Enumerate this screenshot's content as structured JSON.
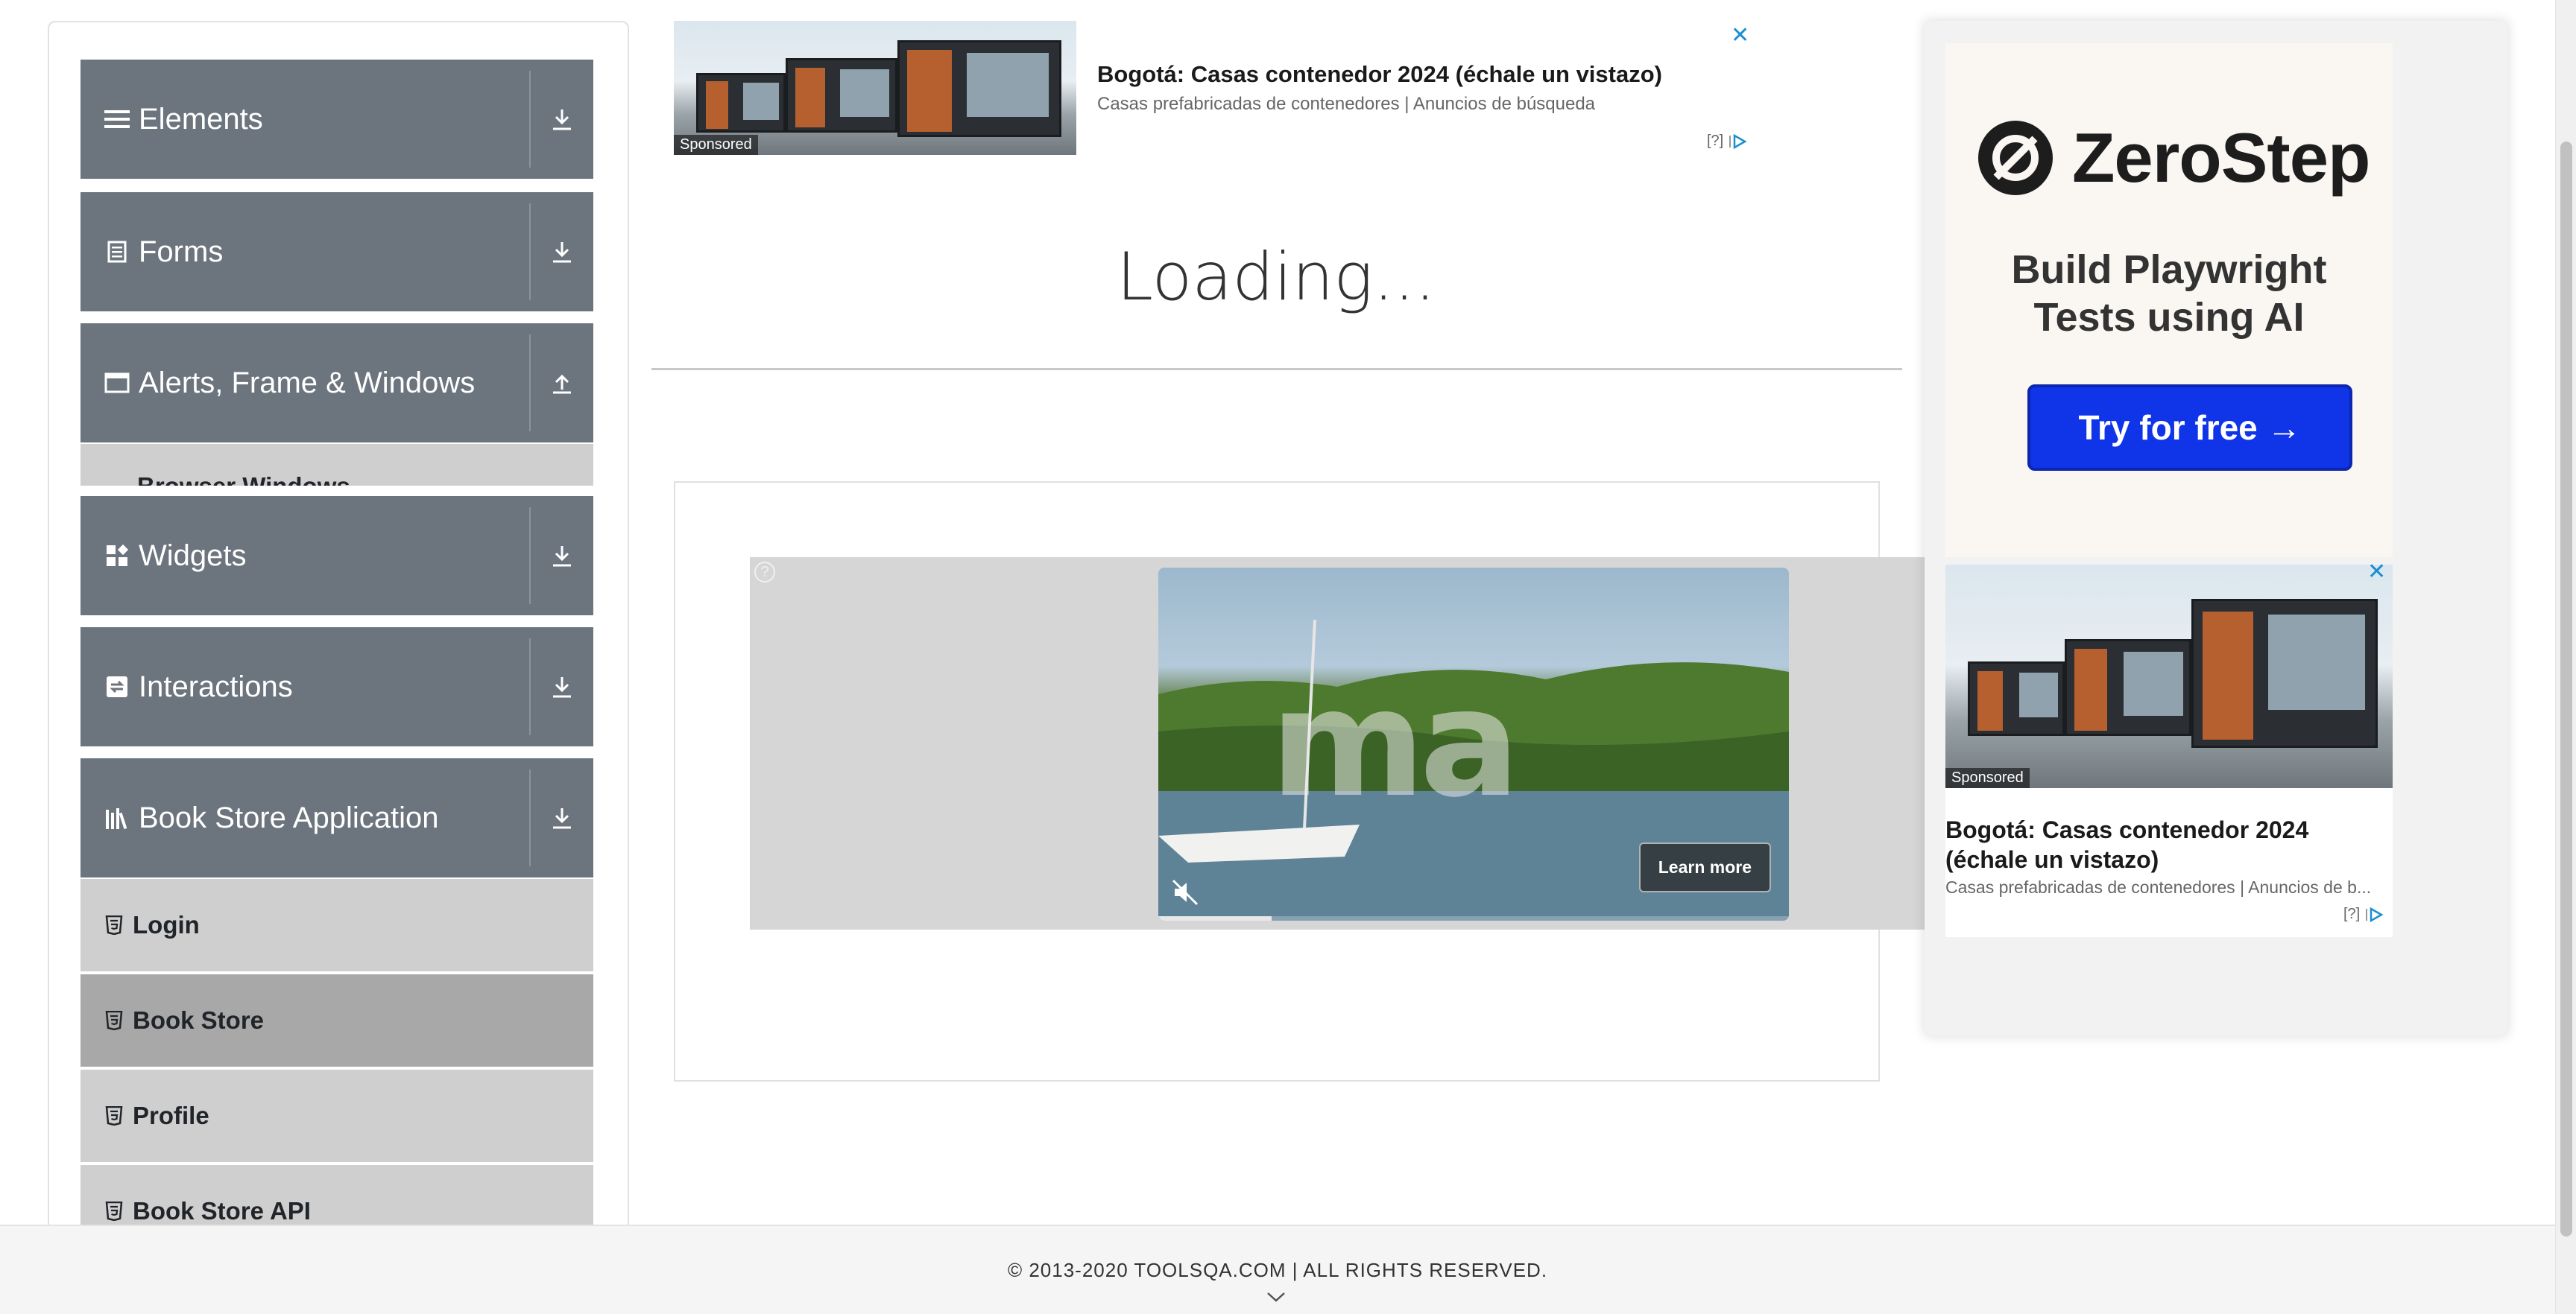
{
  "sidebar": {
    "groups": [
      {
        "label": "Elements",
        "icon": "hamburger-icon",
        "arrow": "download-arrow-icon"
      },
      {
        "label": "Forms",
        "icon": "document-icon",
        "arrow": "download-arrow-icon"
      },
      {
        "label": "Alerts, Frame & Windows",
        "icon": "window-icon",
        "arrow": "upload-arrow-icon"
      },
      {
        "label": "Widgets",
        "icon": "widgets-icon",
        "arrow": "download-arrow-icon"
      },
      {
        "label": "Interactions",
        "icon": "interactions-icon",
        "arrow": "download-arrow-icon"
      },
      {
        "label": "Book Store Application",
        "icon": "books-icon",
        "arrow": "download-arrow-icon"
      }
    ],
    "partial_item": "Browser Windows",
    "bookstore_items": [
      {
        "label": "Login",
        "active": false
      },
      {
        "label": "Book Store",
        "active": true
      },
      {
        "label": "Profile",
        "active": false
      },
      {
        "label": "Book Store API",
        "active": false
      }
    ]
  },
  "top_ad": {
    "headline": "Bogotá: Casas contenedor 2024 (échale un vistazo)",
    "description": "Casas prefabricadas de contenedores | Anuncios de búsqueda",
    "sponsored": "Sponsored",
    "close": "✕",
    "choice": "[?]"
  },
  "main": {
    "loading_text": "Loading..."
  },
  "video_ad": {
    "watermark": "ma",
    "learn_more": "Learn more",
    "help": "?",
    "progress": 0.18
  },
  "right_ad": {
    "brand": "ZeroStep",
    "tagline_line1": "Build Playwright",
    "tagline_line2": "Tests using AI",
    "cta": "Try for free →",
    "second_ad": {
      "sponsored": "Sponsored",
      "headline": "Bogotá: Casas contenedor 2024 (échale un vistazo)",
      "description": "Casas prefabricadas de contenedores | Anuncios de b...",
      "close": "✕",
      "choice": "[?]"
    }
  },
  "footer": {
    "copyright": "© 2013-2020 TOOLSQA.COM | ALL RIGHTS RESERVED."
  },
  "colors": {
    "sidebar_header": "#6c757d",
    "sub_item": "#cfcfcf",
    "sub_item_active": "#a8a8a8",
    "cta_blue": "#1034e8",
    "ad_close": "#1a8fd0"
  }
}
